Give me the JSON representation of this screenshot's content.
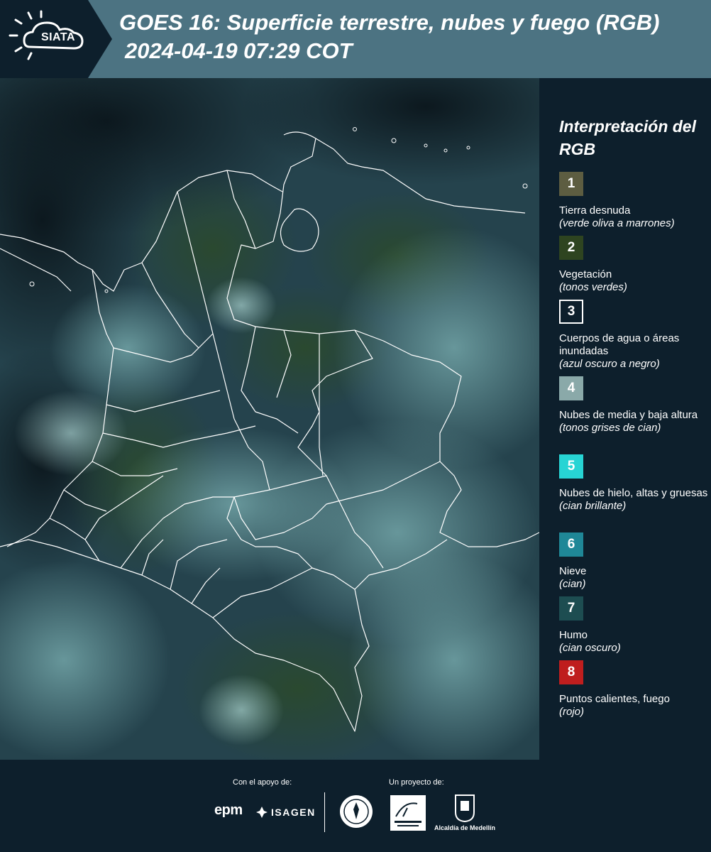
{
  "header": {
    "logo_text": "SIATA",
    "title_line1": "GOES 16: Superficie terrestre, nubes y fuego (RGB)",
    "title_line2": "2024-04-19 07:29 COT"
  },
  "map": {
    "content": "satellite-rgb-composite",
    "colors": {
      "base": "#1e3a44",
      "cloud_cyan": "#6fa3a8",
      "vegetation": "#26412a",
      "ocean_dark": "#0f1e26",
      "borders": "#ffffff"
    }
  },
  "legend": {
    "title": "Interpretación del RGB",
    "items": [
      {
        "number": "1",
        "label": "Tierra desnuda",
        "desc": "(verde oliva a marrones)",
        "color": "#5d5d41"
      },
      {
        "number": "2",
        "label": "Vegetación",
        "desc": "(tonos verdes)",
        "color": "#2e4420"
      },
      {
        "number": "3",
        "label": "Cuerpos de agua o áreas inundadas",
        "desc": "(azul oscuro a negro)",
        "color": "#0d1f2c"
      },
      {
        "number": "4",
        "label": "Nubes de media y baja altura",
        "desc": "(tonos grises de cian)",
        "color": "#8aa9a9"
      },
      {
        "number": "5",
        "label": "Nubes de hielo, altas y gruesas",
        "desc": "(cian brillante)",
        "color": "#27d4d4"
      },
      {
        "number": "6",
        "label": "Nieve",
        "desc": "(cian)",
        "color": "#1f8797"
      },
      {
        "number": "7",
        "label": "Humo",
        "desc": "(cian oscuro)",
        "color": "#1d4d51"
      },
      {
        "number": "8",
        "label": "Puntos calientes, fuego",
        "desc": "(rojo)",
        "color": "#bf1e1e"
      }
    ]
  },
  "footer": {
    "support_label": "Con el apoyo de:",
    "project_label": "Un proyecto de:",
    "sponsors": [
      "epm",
      "ISAGEN"
    ],
    "partners": [
      "Área Metropolitana Valle de Aburrá",
      "Alcaldía de Medellín"
    ],
    "alcaldia_text": "Alcaldía de Medellín"
  }
}
